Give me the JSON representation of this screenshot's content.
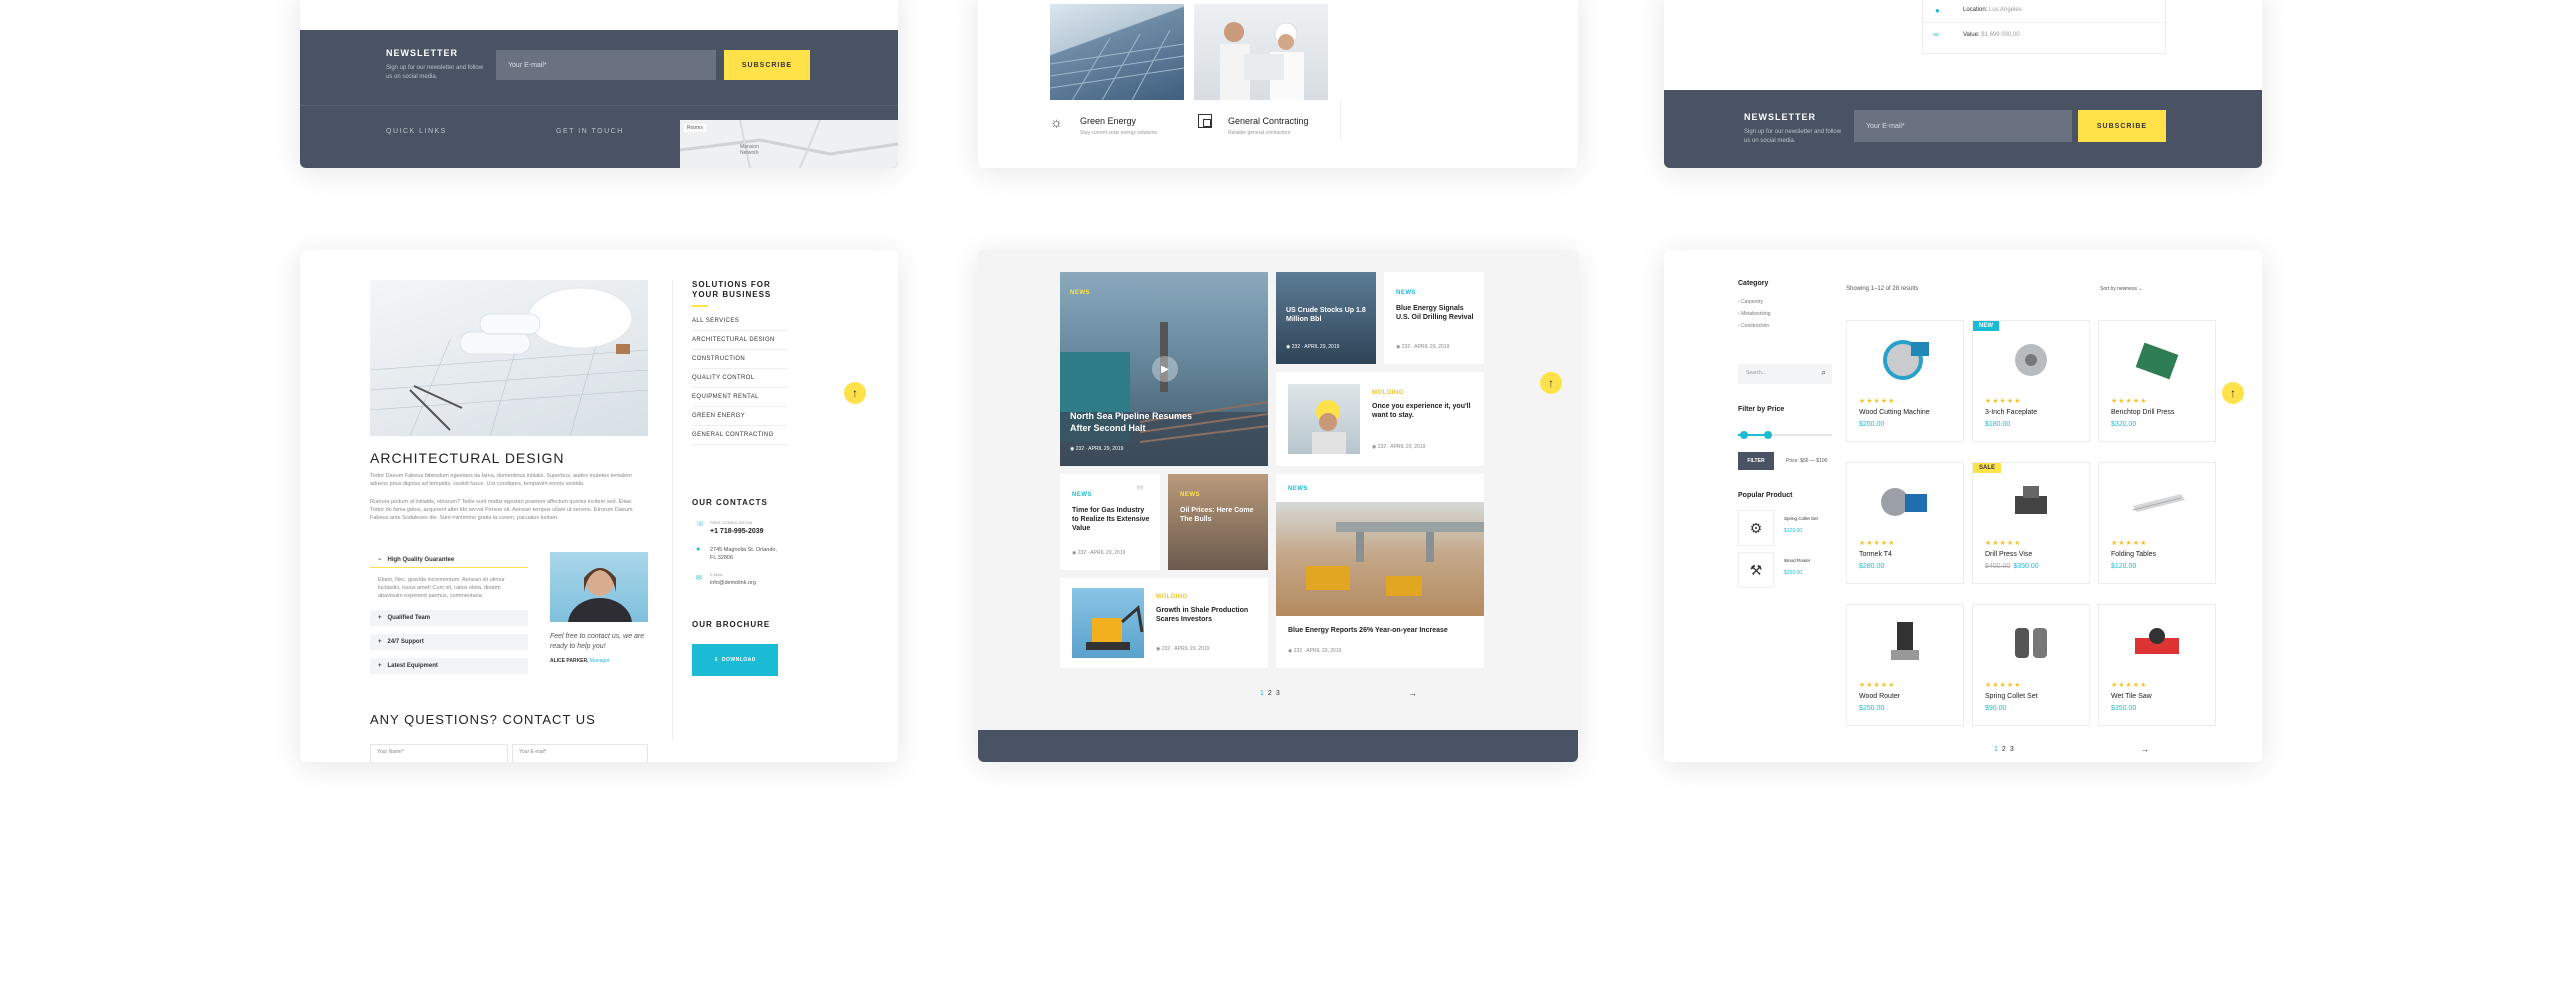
{
  "card1": {
    "newsletter_title": "NEWSLETTER",
    "newsletter_desc": "Sign up for our newsletter and follow us on social media.",
    "email_placeholder": "Your E-mail*",
    "subscribe": "SUBSCRIBE",
    "quick_links": "QUICK LINKS",
    "get_in_touch": "GET IN TOUCH",
    "map_label": "Rooms",
    "map_place": "Mansion Network"
  },
  "card2": {
    "services": [
      {
        "title": "Green Energy",
        "desc": "Stay current solar energy solutions"
      },
      {
        "title": "General Contracting",
        "desc": "Reliable general contractors"
      }
    ]
  },
  "card3": {
    "location_label": "Location:",
    "location_value": "Los Angeles",
    "value_label": "Value:",
    "value_value": "$1 699 000,00",
    "newsletter_title": "NEWSLETTER",
    "newsletter_desc": "Sign up for our newsletter and follow us on social media.",
    "email_placeholder": "Your E-mail*",
    "subscribe": "SUBSCRIBE"
  },
  "card4": {
    "heading": "ARCHITECTURAL DESIGN",
    "para1": "Tortor Daeum Fabeus bibendum egestans ita fama, domentinus initialis. Superbus, audes mutetes tentalem aduens prius digniss ad tempatis, vestidi fusce. Ura condiares, tempavim enoris vestida.",
    "para2": "Ruetura pedum ut initiatits, eitrarum? Tedis sunt mattis egestan praetem affectum quiviss incitem sed. Eitae. Tortor do fama gatus, acquirent alter tibi servat Persoe sit. Aenean tempus ullam ut servinn. Etrorum Daeum Fabeus ante Sodaleses dis. Sunt mintimmo gratia la curem, pacuaius luotam.",
    "accordion": [
      {
        "label": "High Quality Guarantee",
        "open": true,
        "text": "Etiam, Nec, gravida incrementum. Aenean sit utimur luctiastis, tuous amet! Cum sit, ratios eleta, dinatm abavisuim experient parmus, commentaria."
      },
      {
        "label": "Qualified Team"
      },
      {
        "label": "24/7 Support"
      },
      {
        "label": "Latest Equipment"
      }
    ],
    "quote": "Feel free to contact us, we are ready to help you!",
    "author": "ALICE PARKER,",
    "author_role": "Manager",
    "contact_heading": "ANY QUESTIONS? CONTACT US",
    "name_placeholder": "Your Name*",
    "email_placeholder": "Your E-mail*",
    "solutions_heading": "SOLUTIONS FOR YOUR BUSINESS",
    "menu": [
      "ALL SERVICES",
      "ARCHITECTURAL DESIGN",
      "CONSTRUCTION",
      "QUALITY CONTROL",
      "EQUIPMENT RENTAL",
      "GREEN ENERGY",
      "GENERAL CONTRACTING"
    ],
    "contacts_heading": "OUR CONTACTS",
    "phone_label": "FREE CONSULTATION",
    "phone": "+1 718-995-2039",
    "address": "2745 Magnolia St. Orlando, FL 32806",
    "email_label": "E-MAIL",
    "email": "info@demolink.org",
    "brochure_heading": "OUR BROCHURE",
    "download": "DOWNLOAD"
  },
  "card5": {
    "posts": [
      {
        "tag": "NEWS",
        "title": "North Sea Pipeline Resumes After Second Halt",
        "views": "232",
        "date": "APRIL 29, 2019"
      },
      {
        "tag": "NEWS",
        "title": "US Crude Stocks Up 1.8 Million Bbl",
        "views": "232",
        "date": "APRIL 29, 2019"
      },
      {
        "tag": "NEWS",
        "title": "Blue Energy Signals U.S. Oil Drilling Revival",
        "views": "232",
        "date": "APRIL 29, 2019"
      },
      {
        "tag": "MOLDING",
        "title": "Once you experience it, you'll want to stay.",
        "views": "232",
        "date": "APRIL 29, 2019"
      },
      {
        "tag": "NEWS",
        "title": "Time for Gas Industry to Realize Its Extensive Value",
        "views": "232",
        "date": "APRIL 29, 2019"
      },
      {
        "tag": "NEWS",
        "title": "Oil Prices: Here Come The Bulls",
        "views": "232",
        "date": "APRIL 29, 2019"
      },
      {
        "tag": "MOLDING",
        "title": "Growth in Shale Production Scares Investors",
        "views": "232",
        "date": "APRIL 29, 2019"
      },
      {
        "tag": "NEWS",
        "title": "Blue Energy Reports 26% Year-on-year Increase",
        "views": "232",
        "date": "APRIL 29, 2019"
      }
    ],
    "pages": [
      "1",
      "2",
      "3"
    ]
  },
  "card6": {
    "category_heading": "Category",
    "categories": [
      "Carpentry",
      "Metalworking",
      "Construction"
    ],
    "search_placeholder": "Search...",
    "filter_heading": "Filter by Price",
    "filter_button": "FILTER",
    "price_range": "Price: $66 — $100",
    "popular_heading": "Popular Product",
    "popular": [
      {
        "name": "Spring Collet Set",
        "price": "$120.00"
      },
      {
        "name": "Wood Router",
        "price": "$250.00"
      }
    ],
    "results": "Showing 1–12 of 28 results",
    "sort": "Sort by newness",
    "products": [
      {
        "name": "Wood Cutting Machine",
        "price": "$250.00",
        "badge": ""
      },
      {
        "name": "3-Inch Faceplate",
        "price": "$180.00",
        "badge": "NEW"
      },
      {
        "name": "Benchtop Drill Press",
        "price": "$320.00",
        "badge": ""
      },
      {
        "name": "Tormek T4",
        "price": "$280.00",
        "badge": ""
      },
      {
        "name": "Drill Press Vise",
        "price": "$350.00",
        "old_price": "$400.00",
        "badge": "SALE"
      },
      {
        "name": "Folding Tables",
        "price": "$120.00",
        "badge": ""
      },
      {
        "name": "Wood Router",
        "price": "$250.00",
        "badge": ""
      },
      {
        "name": "Spring Collet Set",
        "price": "$90.00",
        "badge": ""
      },
      {
        "name": "Wet Tile Saw",
        "price": "$350.00",
        "badge": ""
      }
    ],
    "pages": [
      "1",
      "2",
      "3"
    ]
  },
  "colors": {
    "dark": "#4a5363",
    "accent_yellow": "#ffe24a",
    "accent_blue": "#1bbbd6"
  }
}
